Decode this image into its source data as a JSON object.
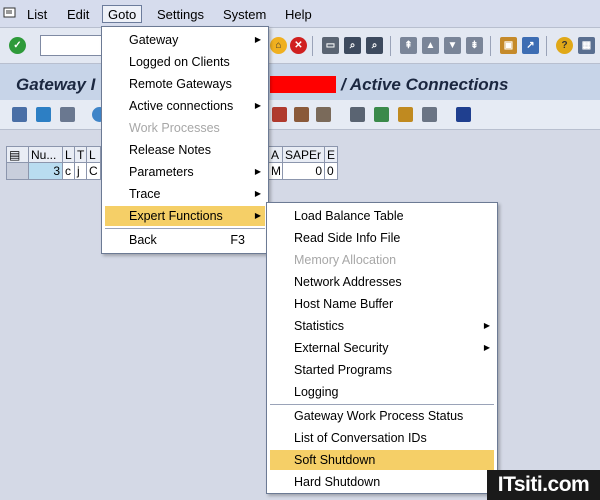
{
  "menubar": {
    "items": [
      "List",
      "Edit",
      "Goto",
      "Settings",
      "System",
      "Help"
    ],
    "active": "Goto"
  },
  "title": {
    "prefix": "Gateway I",
    "suffix": "/ Active Connections"
  },
  "grid": {
    "headers": [
      "Nu...",
      "L",
      "T",
      "L",
      "A",
      "SAPEr",
      "E"
    ],
    "row": [
      "3",
      "c",
      "j",
      "C",
      "M",
      "0",
      "0"
    ]
  },
  "goto_menu": {
    "items": [
      {
        "label": "Gateway",
        "arrow": true
      },
      {
        "label": "Logged on Clients"
      },
      {
        "label": "Remote Gateways"
      },
      {
        "label": "Active connections",
        "arrow": true
      },
      {
        "label": "Work Processes",
        "disabled": true
      },
      {
        "label": "Release Notes"
      },
      {
        "label": "Parameters",
        "arrow": true
      },
      {
        "label": "Trace",
        "arrow": true
      },
      {
        "label": "Expert Functions",
        "arrow": true,
        "highlighted": true
      },
      {
        "label": "Back",
        "shortcut": "F3"
      }
    ]
  },
  "expert_menu": {
    "items": [
      {
        "label": "Load Balance Table"
      },
      {
        "label": "Read Side Info File"
      },
      {
        "label": "Memory Allocation",
        "disabled": true
      },
      {
        "label": "Network Addresses"
      },
      {
        "label": "Host Name Buffer"
      },
      {
        "label": "Statistics",
        "arrow": true
      },
      {
        "label": "External Security",
        "arrow": true
      },
      {
        "label": "Started Programs"
      },
      {
        "label": "Logging"
      },
      {
        "label": "Gateway Work Process Status"
      },
      {
        "label": "List of Conversation IDs"
      },
      {
        "label": "Soft Shutdown",
        "highlighted": true
      },
      {
        "label": "Hard Shutdown"
      }
    ]
  },
  "watermark": "ITsiti.com",
  "colors": {
    "highlight": "#f5cf67",
    "title_redaction": "#ff0000",
    "row_blue": "#b9dcf0"
  }
}
